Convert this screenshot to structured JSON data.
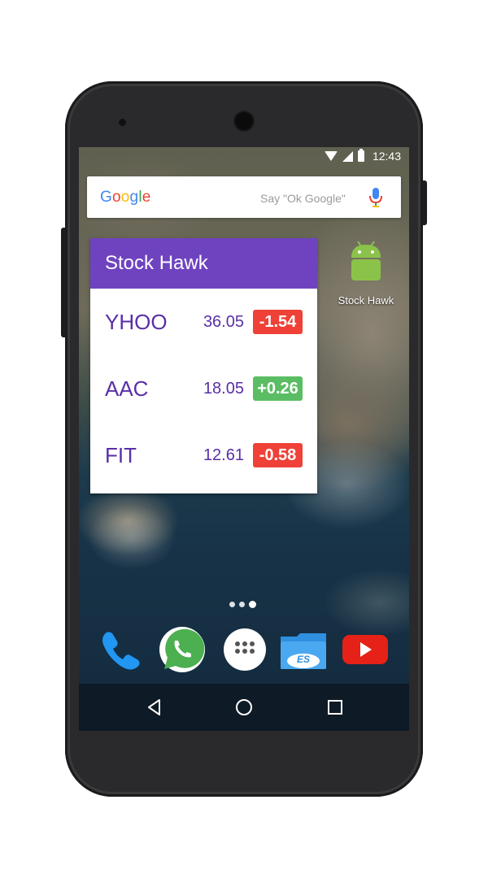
{
  "statusbar": {
    "time": "12:43"
  },
  "search": {
    "logo": "Google",
    "hint": "Say \"Ok Google\""
  },
  "widget": {
    "title": "Stock Hawk",
    "stocks": [
      {
        "symbol": "YHOO",
        "price": "36.05",
        "change": "-1.54",
        "direction": "down"
      },
      {
        "symbol": "AAC",
        "price": "18.05",
        "change": "+0.26",
        "direction": "up"
      },
      {
        "symbol": "FIT",
        "price": "12.61",
        "change": "-0.58",
        "direction": "down"
      }
    ]
  },
  "shortcut": {
    "label": "Stock Hawk",
    "icon": "android-icon"
  },
  "dock": {
    "apps": [
      "phone-icon",
      "whatsapp-icon",
      "app-drawer-icon",
      "es-file-explorer-icon",
      "youtube-icon"
    ]
  },
  "navbar": {
    "buttons": [
      "back-icon",
      "home-icon",
      "recents-icon"
    ]
  },
  "colors": {
    "widget_header": "#6f43c0",
    "text_accent": "#5a2fa8",
    "negative": "#ef4137",
    "positive": "#5bbd63"
  }
}
